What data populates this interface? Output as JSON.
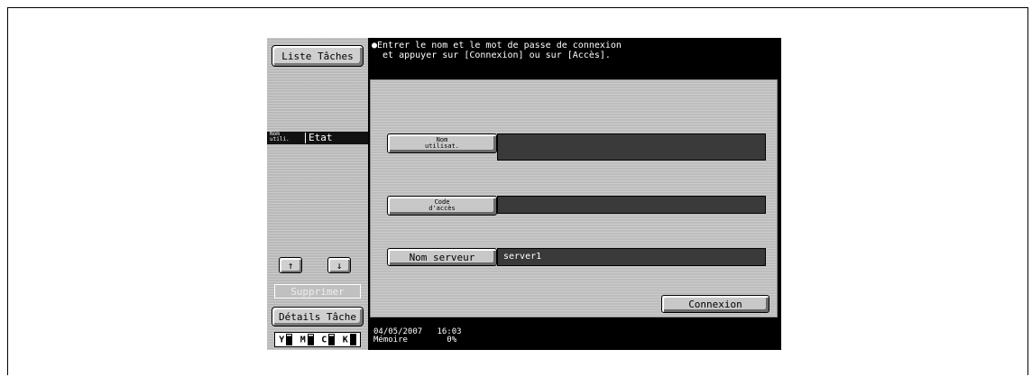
{
  "left_panel": {
    "liste_taches": "Liste Tâches",
    "col_nom": "Nom\nutili.",
    "col_etat": "Etat",
    "arrow_up": "↑",
    "arrow_down": "↓",
    "supprimer": "Supprimer",
    "details_tache": "Détails Tâche",
    "toner": [
      "Y",
      "M",
      "C",
      "K"
    ]
  },
  "message": {
    "line1": "●Entrer le nom et le mot de passe de connexion",
    "line2": "  et appuyer sur [Connexion] ou sur [Accès]."
  },
  "form": {
    "user_label": "Nom\nutilisat.",
    "user_value": "",
    "code_label": "Code\nd'accès",
    "code_value": "",
    "server_label": "Nom serveur",
    "server_value": "server1",
    "connexion": "Connexion"
  },
  "footer": {
    "date": "04/05/2007",
    "time": "16:03",
    "memoire_label": "Mémoire",
    "memoire_value": "0%"
  }
}
